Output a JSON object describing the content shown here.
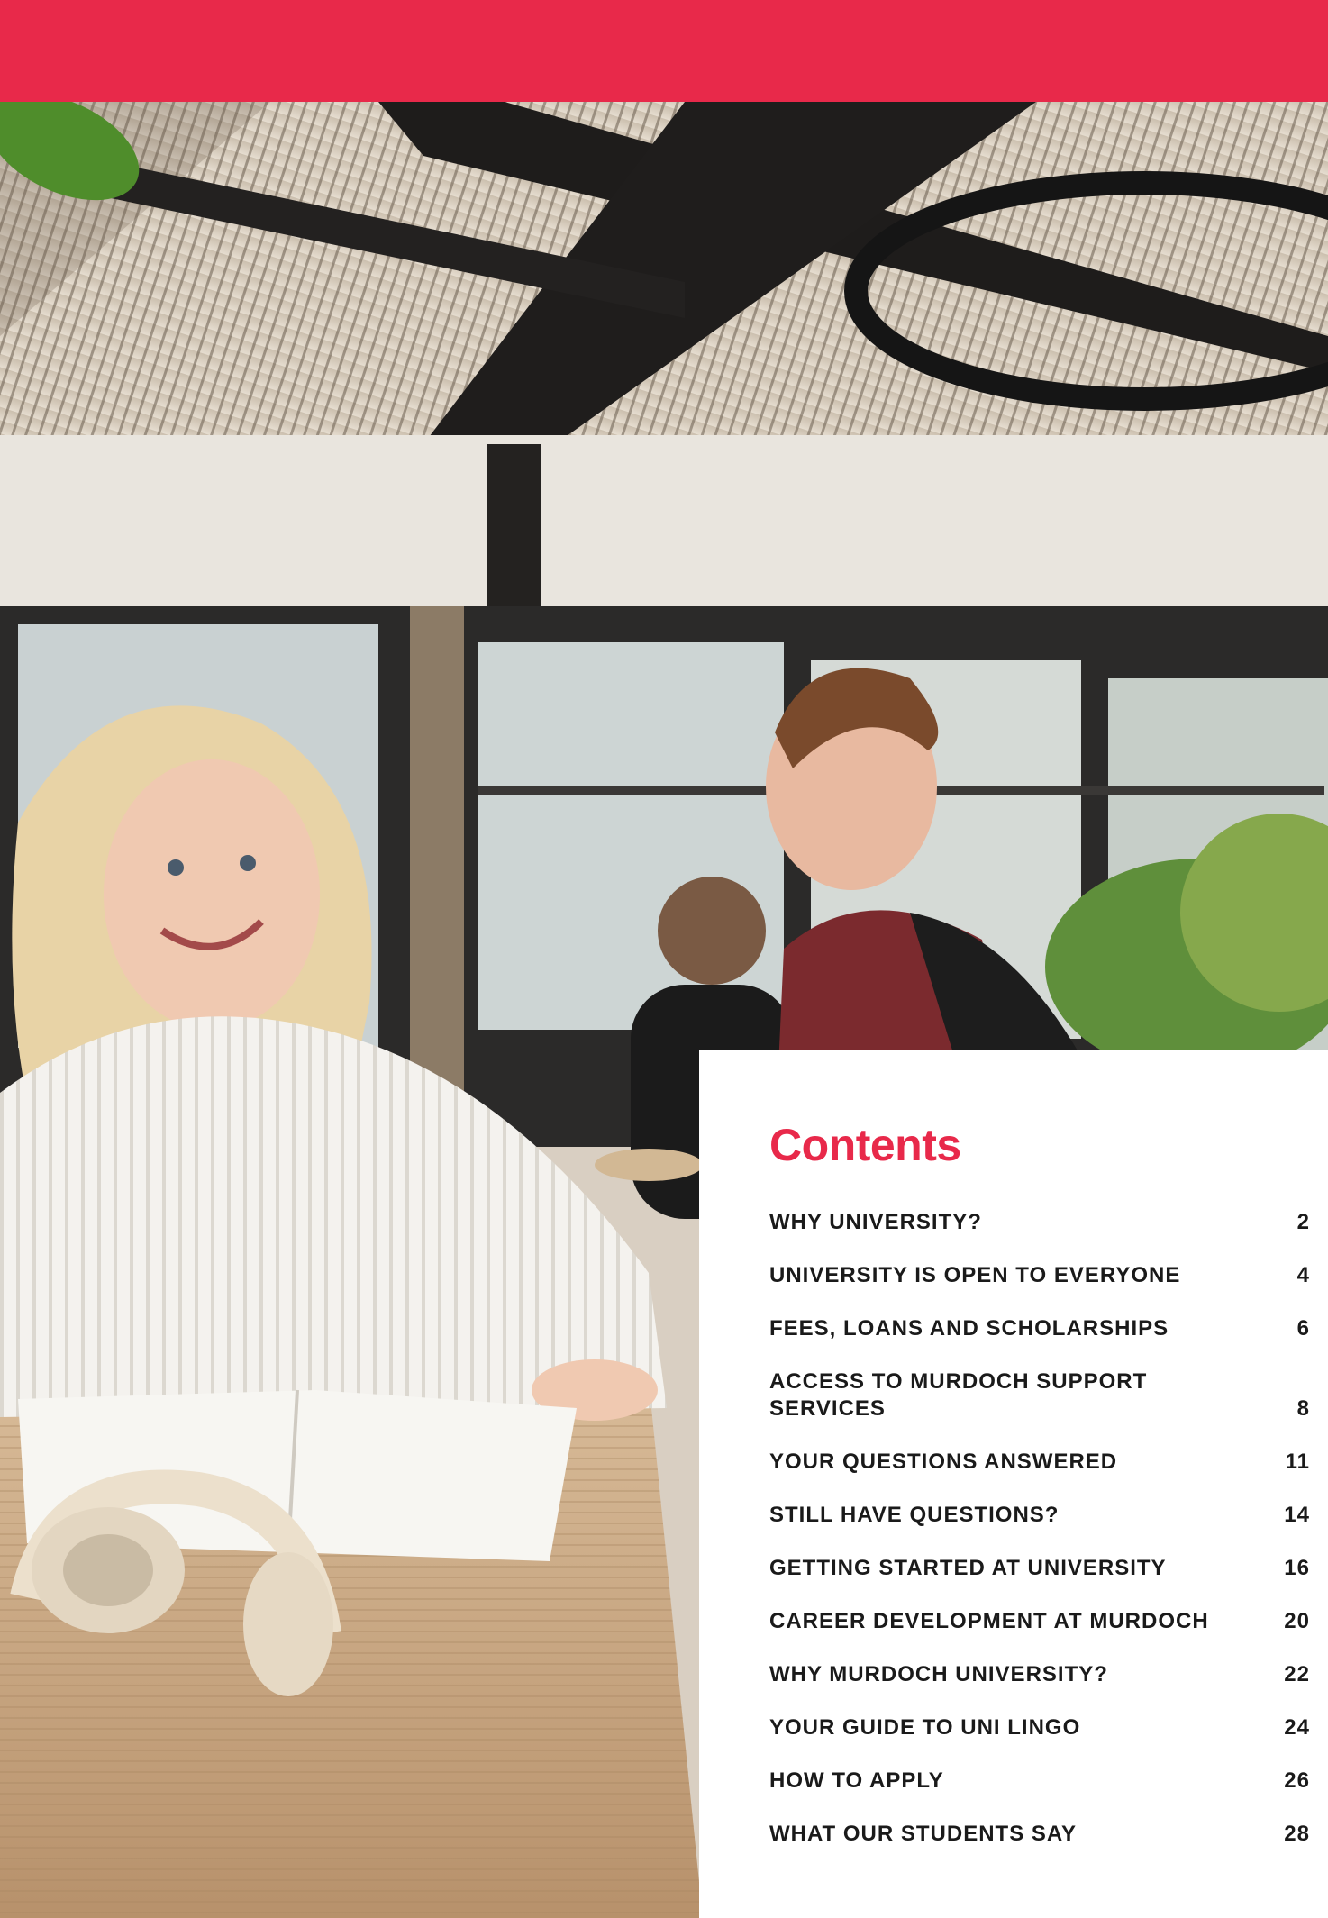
{
  "colors": {
    "brand_red": "#e8294a",
    "text_dark": "#1a1a1a"
  },
  "photo": {
    "description_icon": "students-in-cafe-photo"
  },
  "contents": {
    "title": "Contents",
    "items": [
      {
        "label": "WHY UNIVERSITY?",
        "page": "2"
      },
      {
        "label": "UNIVERSITY IS OPEN TO EVERYONE",
        "page": "4"
      },
      {
        "label": "FEES, LOANS AND SCHOLARSHIPS",
        "page": "6"
      },
      {
        "label": "ACCESS TO MURDOCH SUPPORT SERVICES",
        "page": "8"
      },
      {
        "label": "YOUR QUESTIONS ANSWERED",
        "page": "11"
      },
      {
        "label": "STILL HAVE QUESTIONS?",
        "page": "14"
      },
      {
        "label": "GETTING STARTED AT UNIVERSITY",
        "page": "16"
      },
      {
        "label": "CAREER DEVELOPMENT AT MURDOCH",
        "page": "20"
      },
      {
        "label": "WHY MURDOCH UNIVERSITY?",
        "page": "22"
      },
      {
        "label": "YOUR GUIDE TO UNI LINGO",
        "page": "24"
      },
      {
        "label": "HOW TO APPLY",
        "page": "26"
      },
      {
        "label": "WHAT OUR STUDENTS SAY",
        "page": "28"
      }
    ]
  }
}
